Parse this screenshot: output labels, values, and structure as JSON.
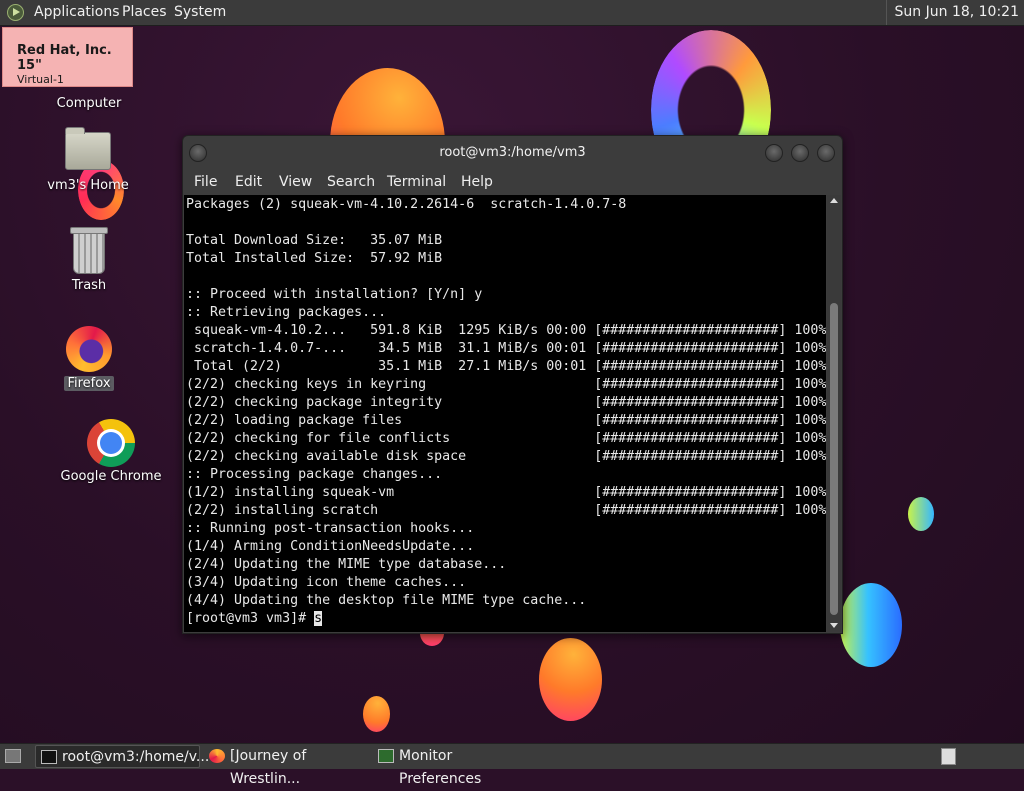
{
  "top_panel": {
    "menus": [
      "Applications",
      "Places",
      "System"
    ],
    "clock": "Sun Jun 18, 10:21"
  },
  "monitor_label": {
    "title": "Red Hat, Inc. 15\"",
    "subtitle": "Virtual-1"
  },
  "desktop_icons": [
    {
      "label": "Computer",
      "icon": "computer-icon"
    },
    {
      "label": "vm3's Home",
      "icon": "home-folder-icon"
    },
    {
      "label": "Trash",
      "icon": "trash-icon"
    },
    {
      "label": "Firefox",
      "icon": "firefox-icon",
      "selected": true
    },
    {
      "label": "Google Chrome",
      "icon": "chrome-icon"
    }
  ],
  "terminal": {
    "title": "root@vm3:/home/vm3",
    "menu": [
      "File",
      "Edit",
      "View",
      "Search",
      "Terminal",
      "Help"
    ],
    "lines": [
      "Packages (2) squeak-vm-4.10.2.2614-6  scratch-1.4.0.7-8",
      "",
      "Total Download Size:   35.07 MiB",
      "Total Installed Size:  57.92 MiB",
      "",
      ":: Proceed with installation? [Y/n] y",
      ":: Retrieving packages...",
      " squeak-vm-4.10.2...   591.8 KiB  1295 KiB/s 00:00 [######################] 100%",
      " scratch-1.4.0.7-...    34.5 MiB  31.1 MiB/s 00:01 [######################] 100%",
      " Total (2/2)            35.1 MiB  27.1 MiB/s 00:01 [######################] 100%",
      "(2/2) checking keys in keyring                     [######################] 100%",
      "(2/2) checking package integrity                   [######################] 100%",
      "(2/2) loading package files                        [######################] 100%",
      "(2/2) checking for file conflicts                  [######################] 100%",
      "(2/2) checking available disk space                [######################] 100%",
      ":: Processing package changes...",
      "(1/2) installing squeak-vm                         [######################] 100%",
      "(2/2) installing scratch                           [######################] 100%",
      ":: Running post-transaction hooks...",
      "(1/4) Arming ConditionNeedsUpdate...",
      "(2/4) Updating the MIME type database...",
      "(3/4) Updating icon theme caches...",
      "(4/4) Updating the desktop file MIME type cache..."
    ],
    "prompt": "[root@vm3 vm3]# ",
    "input": "s"
  },
  "taskbar": {
    "items": [
      {
        "label": "root@vm3:/home/v...",
        "icon": "terminal-icon",
        "active": true
      },
      {
        "label": "[Journey of Wrestlin...",
        "icon": "firefox-icon",
        "active": false
      },
      {
        "label": "Monitor Preferences",
        "icon": "monitor-icon",
        "active": false
      }
    ]
  },
  "colors": {
    "panel_bg": "#3b3b3b",
    "terminal_bg": "#000000",
    "terminal_fg": "#e8e8e8",
    "monitor_label_bg": "#f5b3b3"
  }
}
